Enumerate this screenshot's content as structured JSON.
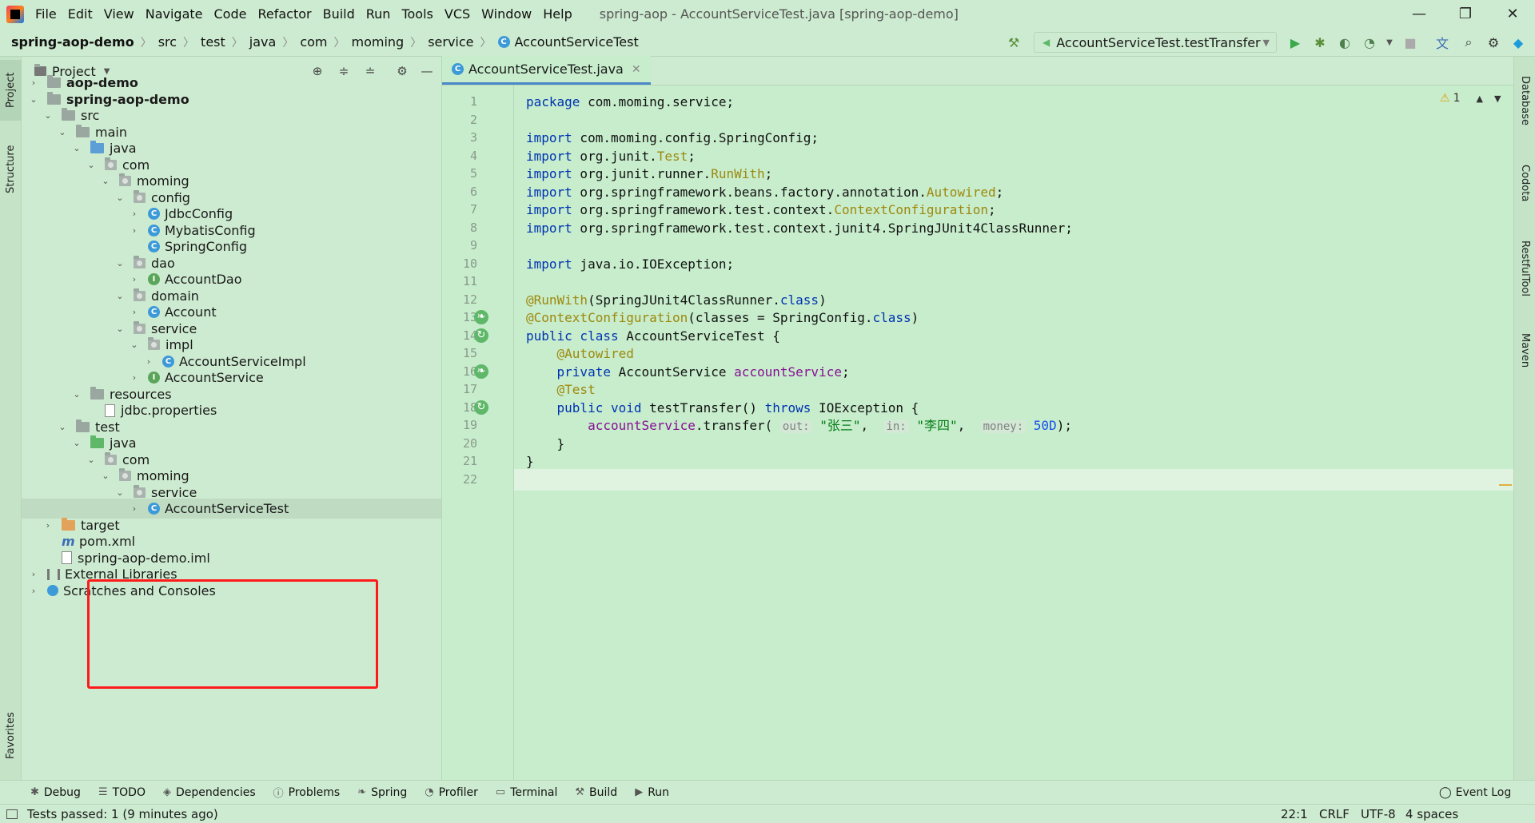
{
  "menu": {
    "items": [
      "File",
      "Edit",
      "View",
      "Navigate",
      "Code",
      "Refactor",
      "Build",
      "Run",
      "Tools",
      "VCS",
      "Window",
      "Help"
    ],
    "window_title": "spring-aop - AccountServiceTest.java [spring-aop-demo]"
  },
  "window_controls": {
    "minimize": "—",
    "restore": "❐",
    "close": "✕"
  },
  "breadcrumbs": [
    "spring-aop-demo",
    "src",
    "test",
    "java",
    "com",
    "moming",
    "service",
    "AccountServiceTest"
  ],
  "run_config": {
    "label": "AccountServiceTest.testTransfer"
  },
  "left_strip": {
    "project": "Project",
    "structure": "Structure",
    "favorites": "Favorites"
  },
  "right_strip": {
    "database": "Database",
    "codota": "Codota",
    "restful": "RestfulTool",
    "maven": "Maven"
  },
  "project_panel": {
    "title": "Project",
    "tree": [
      {
        "label": "aop-demo",
        "indent": 0,
        "chevron": "right",
        "icon": "module",
        "bold": true
      },
      {
        "label": "spring-aop-demo",
        "indent": 0,
        "chevron": "down",
        "icon": "module",
        "bold": true
      },
      {
        "label": "src",
        "indent": 1,
        "chevron": "down",
        "icon": "folder"
      },
      {
        "label": "main",
        "indent": 2,
        "chevron": "down",
        "icon": "folder"
      },
      {
        "label": "java",
        "indent": 3,
        "chevron": "down",
        "icon": "folder-blue"
      },
      {
        "label": "com",
        "indent": 4,
        "chevron": "down",
        "icon": "package"
      },
      {
        "label": "moming",
        "indent": 5,
        "chevron": "down",
        "icon": "package"
      },
      {
        "label": "config",
        "indent": 6,
        "chevron": "down",
        "icon": "package"
      },
      {
        "label": "JdbcConfig",
        "indent": 7,
        "chevron": "right",
        "icon": "class"
      },
      {
        "label": "MybatisConfig",
        "indent": 7,
        "chevron": "right",
        "icon": "class"
      },
      {
        "label": "SpringConfig",
        "indent": 7,
        "chevron": "none",
        "icon": "class"
      },
      {
        "label": "dao",
        "indent": 6,
        "chevron": "down",
        "icon": "package"
      },
      {
        "label": "AccountDao",
        "indent": 7,
        "chevron": "right",
        "icon": "interface"
      },
      {
        "label": "domain",
        "indent": 6,
        "chevron": "down",
        "icon": "package"
      },
      {
        "label": "Account",
        "indent": 7,
        "chevron": "right",
        "icon": "class"
      },
      {
        "label": "service",
        "indent": 6,
        "chevron": "down",
        "icon": "package"
      },
      {
        "label": "impl",
        "indent": 7,
        "chevron": "down",
        "icon": "package"
      },
      {
        "label": "AccountServiceImpl",
        "indent": 8,
        "chevron": "right",
        "icon": "class"
      },
      {
        "label": "AccountService",
        "indent": 7,
        "chevron": "right",
        "icon": "interface"
      },
      {
        "label": "resources",
        "indent": 3,
        "chevron": "down",
        "icon": "folder"
      },
      {
        "label": "jdbc.properties",
        "indent": 4,
        "chevron": "none",
        "icon": "file"
      },
      {
        "label": "test",
        "indent": 2,
        "chevron": "down",
        "icon": "folder"
      },
      {
        "label": "java",
        "indent": 3,
        "chevron": "down",
        "icon": "folder-green"
      },
      {
        "label": "com",
        "indent": 4,
        "chevron": "down",
        "icon": "package"
      },
      {
        "label": "moming",
        "indent": 5,
        "chevron": "down",
        "icon": "package"
      },
      {
        "label": "service",
        "indent": 6,
        "chevron": "down",
        "icon": "package"
      },
      {
        "label": "AccountServiceTest",
        "indent": 7,
        "chevron": "right",
        "icon": "class",
        "selected": true
      },
      {
        "label": "target",
        "indent": 1,
        "chevron": "right",
        "icon": "folder-orange"
      },
      {
        "label": "pom.xml",
        "indent": 1,
        "chevron": "none",
        "icon": "maven"
      },
      {
        "label": "spring-aop-demo.iml",
        "indent": 1,
        "chevron": "none",
        "icon": "file"
      },
      {
        "label": "External Libraries",
        "indent": 0,
        "chevron": "right",
        "icon": "library"
      },
      {
        "label": "Scratches and Consoles",
        "indent": 0,
        "chevron": "right",
        "icon": "scratch"
      }
    ]
  },
  "editor": {
    "tab_label": "AccountServiceTest.java",
    "warnings": "1",
    "line_numbers": [
      "1",
      "2",
      "3",
      "4",
      "5",
      "6",
      "7",
      "8",
      "9",
      "10",
      "11",
      "12",
      "13",
      "14",
      "15",
      "16",
      "17",
      "18",
      "19",
      "20",
      "21",
      "22"
    ],
    "lines": [
      [
        {
          "t": "package",
          "c": "kw"
        },
        {
          "t": " com.moming.service;"
        }
      ],
      [],
      [
        {
          "t": "import",
          "c": "kw"
        },
        {
          "t": " com.moming.config.SpringConfig;"
        }
      ],
      [
        {
          "t": "import",
          "c": "kw"
        },
        {
          "t": " org.junit."
        },
        {
          "t": "Test",
          "c": "ann"
        },
        {
          "t": ";"
        }
      ],
      [
        {
          "t": "import",
          "c": "kw"
        },
        {
          "t": " org.junit.runner."
        },
        {
          "t": "RunWith",
          "c": "ann"
        },
        {
          "t": ";"
        }
      ],
      [
        {
          "t": "import",
          "c": "kw"
        },
        {
          "t": " org.springframework.beans.factory.annotation."
        },
        {
          "t": "Autowired",
          "c": "ann"
        },
        {
          "t": ";"
        }
      ],
      [
        {
          "t": "import",
          "c": "kw"
        },
        {
          "t": " org.springframework.test.context."
        },
        {
          "t": "ContextConfiguration",
          "c": "ann"
        },
        {
          "t": ";"
        }
      ],
      [
        {
          "t": "import",
          "c": "kw"
        },
        {
          "t": " org.springframework.test.context.junit4.SpringJUnit4ClassRunner;"
        }
      ],
      [],
      [
        {
          "t": "import",
          "c": "kw"
        },
        {
          "t": " java.io.IOException;"
        }
      ],
      [],
      [
        {
          "t": "@RunWith",
          "c": "ann"
        },
        {
          "t": "(SpringJUnit4ClassRunner."
        },
        {
          "t": "class",
          "c": "kw"
        },
        {
          "t": ")"
        }
      ],
      [
        {
          "t": "@ContextConfiguration",
          "c": "ann"
        },
        {
          "t": "(classes = SpringConfig."
        },
        {
          "t": "class",
          "c": "kw"
        },
        {
          "t": ")"
        }
      ],
      [
        {
          "t": "public class",
          "c": "kw"
        },
        {
          "t": " AccountServiceTest {"
        }
      ],
      [
        {
          "t": "    "
        },
        {
          "t": "@Autowired",
          "c": "ann"
        }
      ],
      [
        {
          "t": "    "
        },
        {
          "t": "private",
          "c": "kw"
        },
        {
          "t": " AccountService "
        },
        {
          "t": "accountService",
          "c": "fld"
        },
        {
          "t": ";"
        }
      ],
      [
        {
          "t": "    "
        },
        {
          "t": "@Test",
          "c": "ann"
        }
      ],
      [
        {
          "t": "    "
        },
        {
          "t": "public void",
          "c": "kw"
        },
        {
          "t": " testTransfer() "
        },
        {
          "t": "throws",
          "c": "kw"
        },
        {
          "t": " IOException {"
        }
      ],
      [
        {
          "t": "        "
        },
        {
          "t": "accountService",
          "c": "fld"
        },
        {
          "t": ".transfer( "
        },
        {
          "t": "out:",
          "c": "hint"
        },
        {
          "t": " "
        },
        {
          "t": "\"张三\"",
          "c": "str"
        },
        {
          "t": ",  "
        },
        {
          "t": "in:",
          "c": "hint"
        },
        {
          "t": " "
        },
        {
          "t": "\"李四\"",
          "c": "str"
        },
        {
          "t": ",  "
        },
        {
          "t": "money:",
          "c": "hint"
        },
        {
          "t": " "
        },
        {
          "t": "50D",
          "c": "num"
        },
        {
          "t": ");"
        }
      ],
      [
        {
          "t": "    }"
        }
      ],
      [
        {
          "t": "}"
        }
      ],
      []
    ]
  },
  "bottom_tools": [
    "Debug",
    "TODO",
    "Dependencies",
    "Problems",
    "Spring",
    "Profiler",
    "Terminal",
    "Build",
    "Run"
  ],
  "event_log": "Event Log",
  "status": {
    "message": "Tests passed: 1 (9 minutes ago)",
    "position": "22:1",
    "line_sep": "CRLF",
    "encoding": "UTF-8",
    "indent": "4 spaces"
  },
  "colors": {
    "background": "#cdebd0",
    "editor_bg": "#c7edcc",
    "highlight_box": "#ff1a1a",
    "keyword": "#0033b3",
    "annotation": "#9e880d",
    "string": "#067d17"
  }
}
